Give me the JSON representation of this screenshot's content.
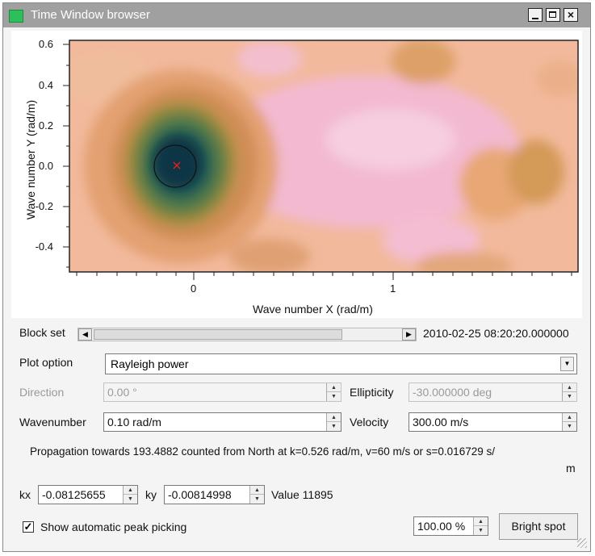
{
  "window": {
    "title": "Time Window browser",
    "controls": {
      "minimize": "_",
      "close": "×"
    }
  },
  "plot": {
    "ylabel": "Wave number Y (rad/m)",
    "xlabel": "Wave number X (rad/m)",
    "y_ticks": [
      "0.6",
      "0.4",
      "0.2",
      "0.0",
      "-0.2",
      "-0.4"
    ],
    "x_ticks": [
      "0",
      "1"
    ],
    "colors": {
      "pink": "#f3b8d1",
      "peach": "#f0b48f",
      "orange": "#dd9a5e",
      "olive": "#9e8a3e",
      "teal": "#2d6a5a",
      "dark": "#123c4a",
      "peak_marker": "#e0201c"
    }
  },
  "block_set": {
    "label": "Block set",
    "timestamp": "2010-02-25 08:20:20.000000"
  },
  "plot_option": {
    "label": "Plot option",
    "value": "Rayleigh power"
  },
  "direction": {
    "label": "Direction",
    "value": "0.00 °"
  },
  "ellipticity": {
    "label": "Ellipticity",
    "value": "-30.000000 deg"
  },
  "wavenumber": {
    "label": "Wavenumber",
    "value": "0.10 rad/m"
  },
  "velocity": {
    "label": "Velocity",
    "value": "300.00 m/s"
  },
  "propagation_text": "Propagation towards 193.4882 counted from North at k=0.526 rad/m, v=60 m/s or s=0.016729 s/",
  "propagation_text_2": "m",
  "kx": {
    "label": "kx",
    "value": "-0.08125655"
  },
  "ky": {
    "label": "ky",
    "value": "-0.00814998"
  },
  "value_text": "Value 11895",
  "peak_picking": {
    "label": "Show automatic peak picking",
    "checked_mark": "✓"
  },
  "zoom": {
    "value": "100.00 %"
  },
  "bright_spot_label": "Bright spot"
}
